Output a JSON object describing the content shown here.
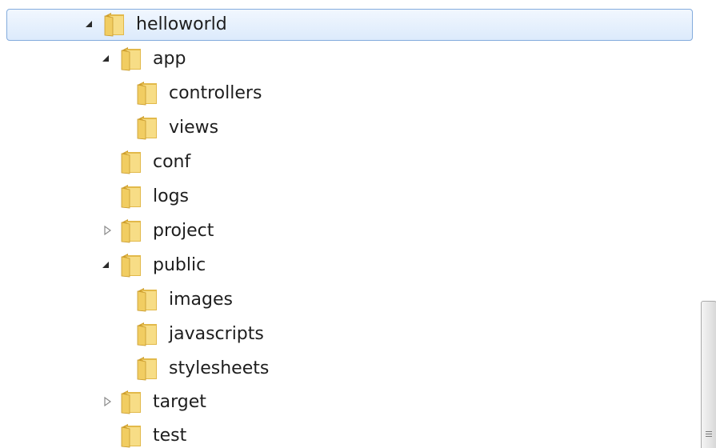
{
  "tree": {
    "items": [
      {
        "label": "helloworld",
        "expand": "expanded",
        "selected": true
      },
      {
        "label": "app",
        "expand": "expanded"
      },
      {
        "label": "controllers",
        "expand": "none"
      },
      {
        "label": "views",
        "expand": "none"
      },
      {
        "label": "conf",
        "expand": "none"
      },
      {
        "label": "logs",
        "expand": "none"
      },
      {
        "label": "project",
        "expand": "collapsed"
      },
      {
        "label": "public",
        "expand": "expanded"
      },
      {
        "label": "images",
        "expand": "none"
      },
      {
        "label": "javascripts",
        "expand": "none"
      },
      {
        "label": "stylesheets",
        "expand": "none"
      },
      {
        "label": "target",
        "expand": "collapsed"
      },
      {
        "label": "test",
        "expand": "none"
      }
    ]
  },
  "icons": {
    "folder": "folder-icon",
    "expanded": "expanded-triangle-icon",
    "collapsed": "collapsed-triangle-icon"
  },
  "colors": {
    "selection_border": "#84acdd",
    "selection_fill_top": "#f1f7fe",
    "selection_fill_bottom": "#dceafc",
    "folder_front": "#f5d77a",
    "folder_back": "#e2b94a",
    "text": "#1e1e1e"
  }
}
